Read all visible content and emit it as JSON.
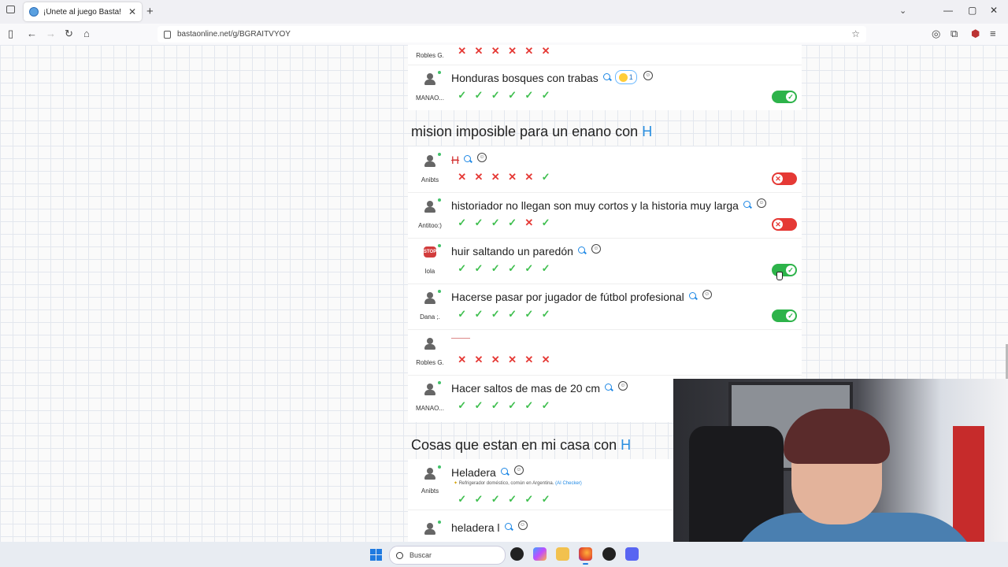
{
  "browser": {
    "tab_title": "¡Únete al juego Basta!",
    "tab_close": "✕",
    "new_tab": "+",
    "url": "bastaonline.net/g/BGRAITVYOY",
    "window_controls": [
      "—",
      "▢",
      "✕"
    ]
  },
  "colors": {
    "ok": "#3fbf4f",
    "no": "#e53935",
    "accent": "#2a8fe0",
    "toggle_on": "#2db34a",
    "toggle_off": "#e53935"
  },
  "top_rows": [
    {
      "user": "Robles G.",
      "answer": "",
      "marks": [
        "x",
        "x",
        "x",
        "x",
        "x",
        "x"
      ]
    },
    {
      "user": "MANAO...",
      "answer": "Honduras bosques con trabas",
      "reaction": "1",
      "marks": [
        "v",
        "v",
        "v",
        "v",
        "v",
        "v"
      ],
      "toggle": "on"
    }
  ],
  "section1": {
    "title": "mision imposible para un enano con ",
    "letter": "H",
    "rows": [
      {
        "user": "Anibts",
        "answer": "H",
        "marks": [
          "x",
          "x",
          "x",
          "x",
          "x",
          "v"
        ],
        "toggle": "off"
      },
      {
        "user": "Antitoo:)",
        "answer": "historiador no llegan son muy cortos y la historia muy larga",
        "marks": [
          "v",
          "v",
          "v",
          "v",
          "x",
          "v"
        ],
        "toggle": "off"
      },
      {
        "user": "lola",
        "answer": "huir saltando un paredón",
        "marks": [
          "v",
          "v",
          "v",
          "v",
          "v",
          "v"
        ],
        "toggle": "on"
      },
      {
        "user": "Dana ;.",
        "answer": "Hacerse pasar por jugador de fútbol profesional",
        "marks": [
          "v",
          "v",
          "v",
          "v",
          "v",
          "v"
        ],
        "toggle": "on"
      },
      {
        "user": "Robles G.",
        "answer": "",
        "marks": [
          "x",
          "x",
          "x",
          "x",
          "x",
          "x"
        ]
      },
      {
        "user": "MANAO...",
        "answer": "Hacer saltos de mas de 20 cm",
        "marks": [
          "v",
          "v",
          "v",
          "v",
          "v",
          "v"
        ]
      }
    ]
  },
  "section2": {
    "title": "Cosas que estan en mi casa con ",
    "letter": "H",
    "rows": [
      {
        "user": "Anibts",
        "answer": "Heladera",
        "note": "Refrigerador doméstico, común en Argentina.",
        "note_tag": "(AI Checker)",
        "marks": [
          "v",
          "v",
          "v",
          "v",
          "v",
          "v"
        ]
      },
      {
        "user": "",
        "answer": "heladera l"
      }
    ]
  },
  "taskbar": {
    "search_label": "Buscar"
  }
}
